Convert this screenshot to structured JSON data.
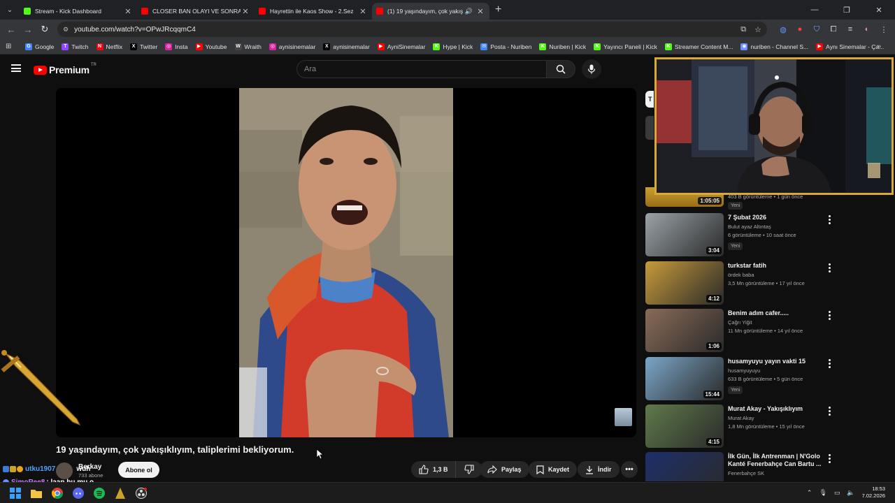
{
  "browser": {
    "tabs": [
      {
        "title": "Stream - Kick Dashboard",
        "icon": "kick-icon",
        "color": "#53fc18",
        "active": false
      },
      {
        "title": "CLOSER BAN OLAYI VE SONRAS",
        "icon": "youtube-icon",
        "color": "#ff0000",
        "active": false
      },
      {
        "title": "Hayrettin ile Kaos Show - 2.Sez",
        "icon": "youtube-icon",
        "color": "#ff0000",
        "active": false
      },
      {
        "title": "(1) 19 yaşındayım, çok yakış",
        "icon": "youtube-icon",
        "color": "#ff0000",
        "active": true
      }
    ],
    "url": "youtube.com/watch?v=OPwJRcqqmC4",
    "bookmarks": [
      {
        "label": "Google",
        "color": "#4285f4",
        "glyph": "G"
      },
      {
        "label": "Twitch",
        "color": "#9146ff",
        "glyph": "T"
      },
      {
        "label": "Netflix",
        "color": "#e50914",
        "glyph": "N"
      },
      {
        "label": "Twitter",
        "color": "#000000",
        "glyph": "X"
      },
      {
        "label": "Insta",
        "color": "#d6249f",
        "glyph": "◎"
      },
      {
        "label": "Youtube",
        "color": "#ff0000",
        "glyph": "▶"
      },
      {
        "label": "Wraith",
        "color": "#444444",
        "glyph": "W"
      },
      {
        "label": "aynisinemalar",
        "color": "#d6249f",
        "glyph": "◎"
      },
      {
        "label": "aynisinemalar",
        "color": "#000000",
        "glyph": "X"
      },
      {
        "label": "AyniSinemalar",
        "color": "#ff0000",
        "glyph": "▶"
      },
      {
        "label": "Hype | Kick",
        "color": "#53fc18",
        "glyph": "K"
      },
      {
        "label": "Posta - Nuriben",
        "color": "#4285f4",
        "glyph": "✉"
      },
      {
        "label": "Nuriben | Kick",
        "color": "#53fc18",
        "glyph": "K"
      },
      {
        "label": "Yayıncı Paneli | Kick",
        "color": "#53fc18",
        "glyph": "K"
      },
      {
        "label": "Streamer Content M...",
        "color": "#53fc18",
        "glyph": "K"
      },
      {
        "label": "nuriben - Channel S...",
        "color": "#6e8efb",
        "glyph": "◉"
      },
      {
        "label": "Aynı Sinemalar - Ça...",
        "color": "#ff0000",
        "glyph": "▶"
      }
    ]
  },
  "youtube": {
    "logo_text": "Premium",
    "country_code": "TR",
    "search_placeholder": "Ara",
    "video": {
      "title": "19 yaşındayım, çok yakışıklıyım, taliplerimi bekliyorum.",
      "channel": "Berkay",
      "subscribers": "733 abone",
      "subscribe_label": "Abone ol",
      "likes": "1,3 B",
      "share_label": "Paylaş",
      "save_label": "Kaydet",
      "download_label": "İndir"
    },
    "partial_rec": {
      "duration": "1:05:05",
      "meta": "403 B görüntüleme • 1 gün önce",
      "badge": "Yeni"
    },
    "recommendations": [
      {
        "title": "7 Şubat 2026",
        "channel": "Bulut ayaz Altıntaş",
        "meta": "6 görüntüleme • 10 saat önce",
        "badge": "Yeni",
        "duration": "3:04",
        "thumb": "#9aa3a8"
      },
      {
        "title": "turkstar fatih",
        "channel": "ördek baba",
        "meta": "3,5 Mn görüntüleme • 17 yıl önce",
        "badge": "",
        "duration": "4:12",
        "thumb": "#c79a3a"
      },
      {
        "title": "Benim adım cafer.....",
        "channel": "Çağrı Yiğit",
        "meta": "11 Mn görüntüleme • 14 yıl önce",
        "badge": "",
        "duration": "1:06",
        "thumb": "#8a6b58"
      },
      {
        "title": "husamyuyu yayın vakti 15",
        "channel": "husamyuyuyu",
        "meta": "633 B görüntüleme • 5 gün önce",
        "badge": "Yeni",
        "duration": "15:44",
        "thumb": "#7aa6c9"
      },
      {
        "title": "Murat Akay - Yakışıklıyım",
        "channel": "Murat Akay",
        "meta": "1,8 Mn görüntüleme • 15 yıl önce",
        "badge": "",
        "duration": "4:15",
        "thumb": "#5f7a4a"
      },
      {
        "title": "İlk Gün, İlk Antrenman | N'Golo Kanté Fenerbahçe Can Bartu ...",
        "channel": "Fenerbahçe SK",
        "meta": "",
        "badge": "",
        "duration": "",
        "thumb": "#1d2f6b"
      }
    ]
  },
  "chat": [
    {
      "user": "utku1907",
      "text": "wuh",
      "color": "#4aa3ff"
    },
    {
      "user": "SimoRee8",
      "text": ": laan bu mu o",
      "color": "#c77dff"
    }
  ],
  "taskbar": {
    "time": "18:53",
    "date": "7.02.2026"
  }
}
